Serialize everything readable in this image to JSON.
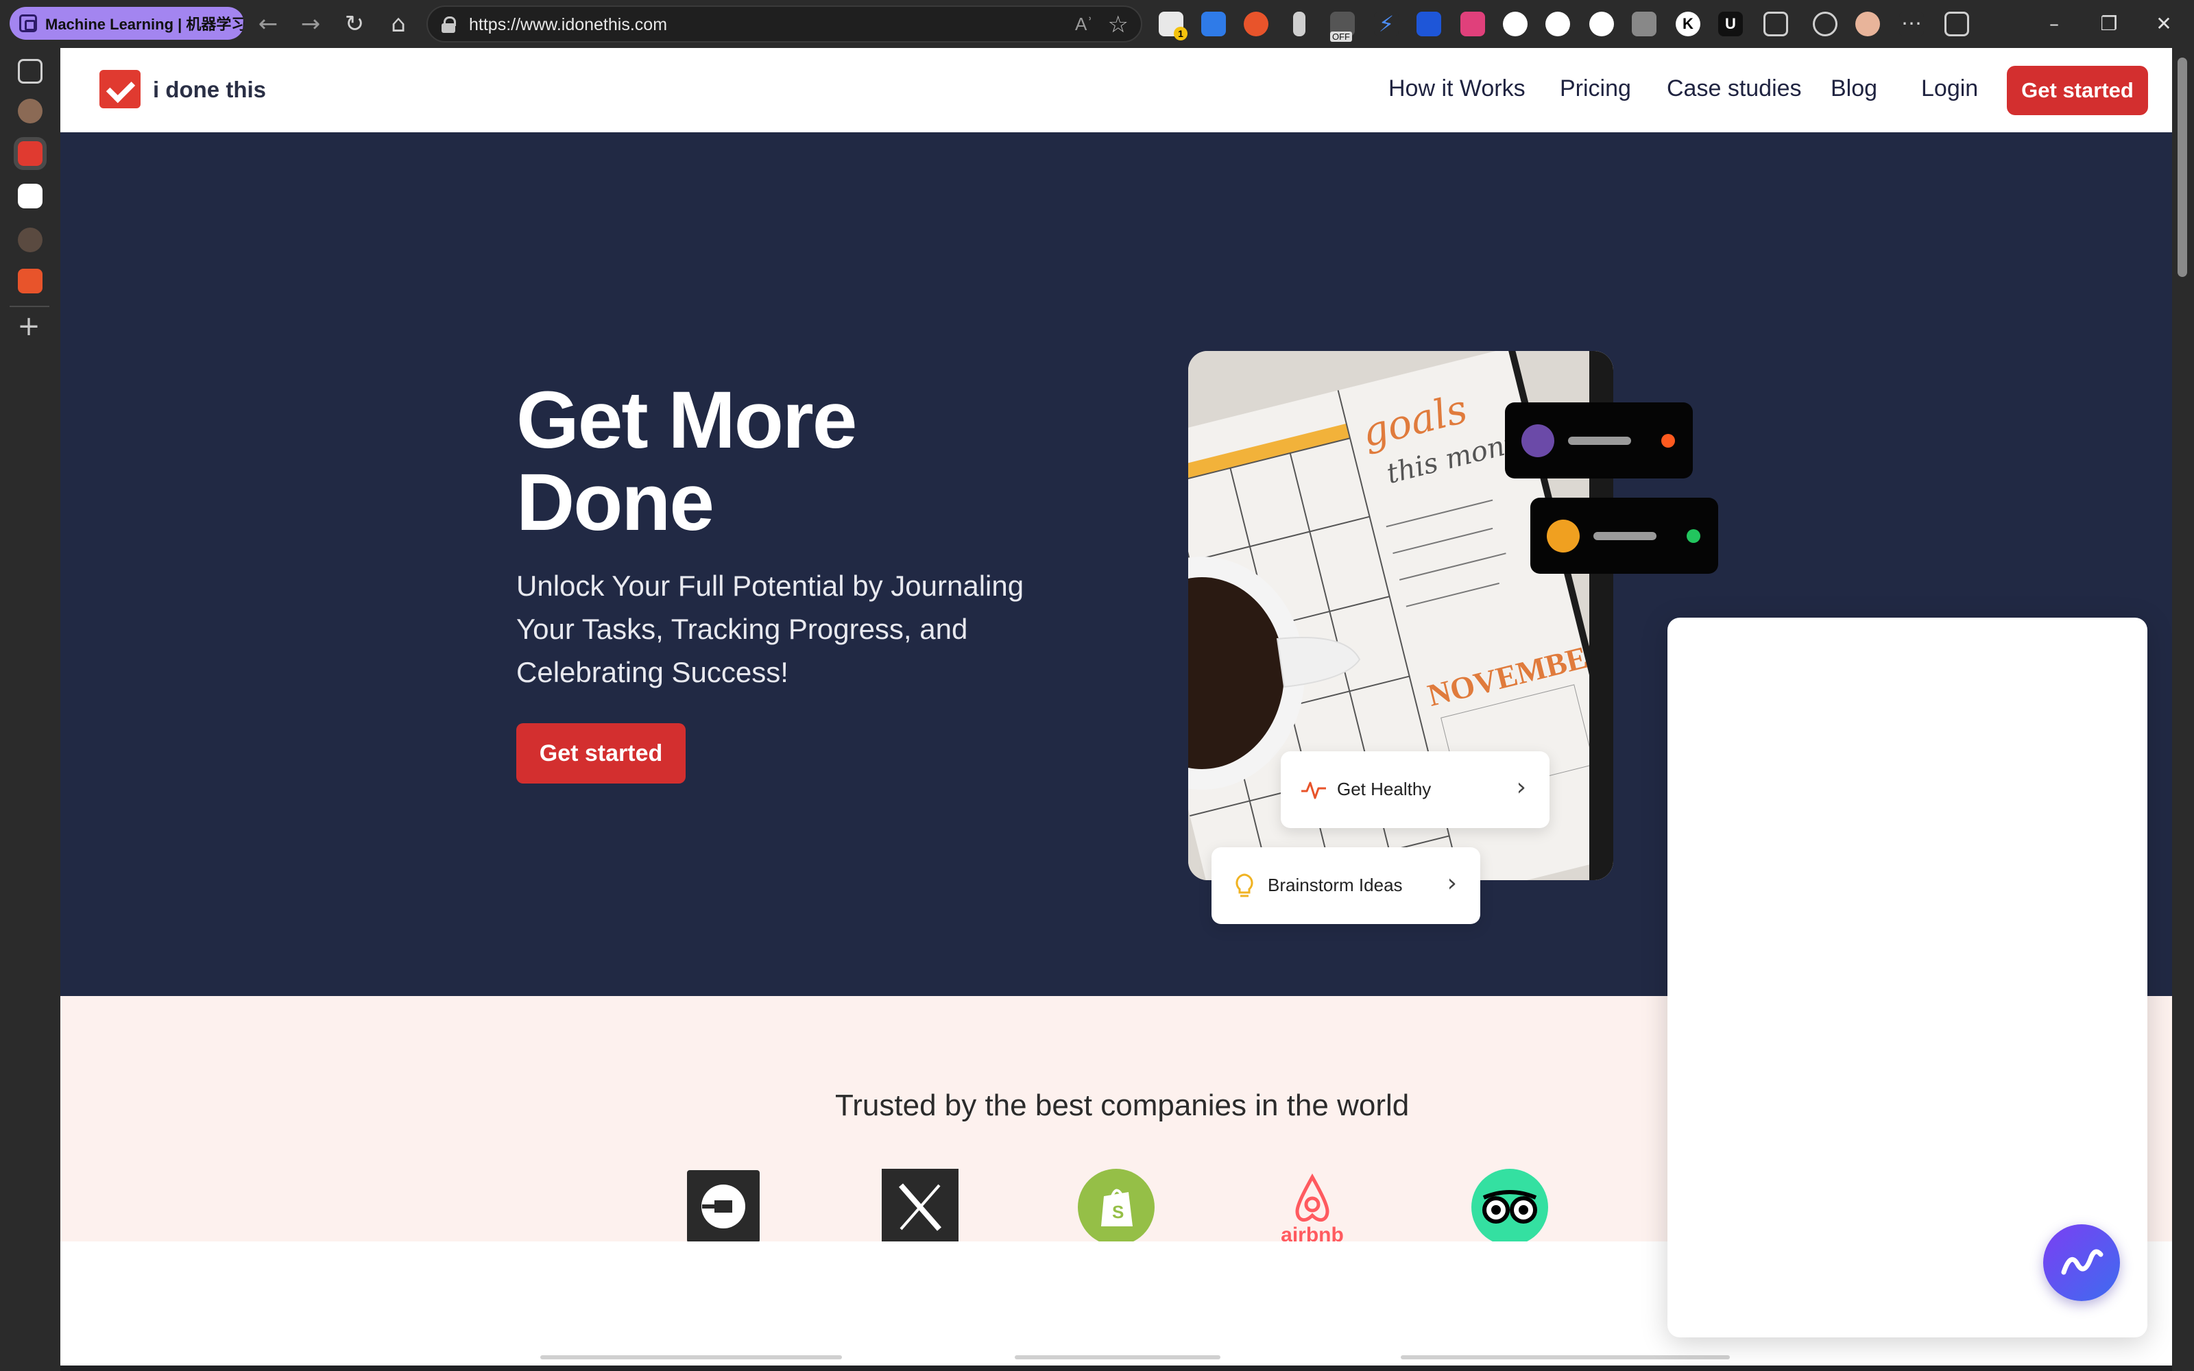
{
  "browser": {
    "profile_label": "Machine Learning | 机器学习",
    "url": "https://www.idonethis.com",
    "read_aloud": "Aʾ",
    "nav_icons": {
      "back": "←",
      "forward": "→",
      "refresh": "↻",
      "home": "⌂"
    },
    "star_glyph": "☆",
    "window_controls": {
      "minimize": "–",
      "restore": "❐",
      "close": "✕"
    },
    "more_glyph": "⋯",
    "add_tab_glyph": "+",
    "extension_badges": {
      "ext1": "1",
      "ext_off": "OFF",
      "ext_k": "K",
      "ext_u": "U"
    }
  },
  "site": {
    "logo_text": "i done this",
    "nav": {
      "how_it_works": "How it Works",
      "pricing": "Pricing",
      "case_studies": "Case studies",
      "blog": "Blog",
      "login": "Login",
      "get_started": "Get started"
    },
    "hero": {
      "title": "Get More Done",
      "subtitle": "Unlock Your Full Potential by Journaling Your Tasks, Tracking Progress, and Celebrating Success!",
      "cta": "Get started",
      "photo_text": {
        "goals": "goals",
        "this_month": "this month",
        "month_name": "NOVEMBER"
      },
      "chips": {
        "healthy": {
          "label": "Get Healthy",
          "arrow": "›"
        },
        "brainstorm": {
          "label": "Brainstorm Ideas",
          "arrow": "›"
        }
      },
      "status_colors": {
        "user1": "#ff5a1f",
        "user2": "#22c55e"
      }
    },
    "trusted": {
      "title": "Trusted by the best companies in the world",
      "brands": [
        "uber-logo",
        "x-logo",
        "shopify-logo",
        "airbnb-logo",
        "tripadvisor-logo"
      ],
      "airbnb_label": "airbnb"
    }
  },
  "colors": {
    "hero_bg": "#212944",
    "accent_red": "#d32f2f",
    "trusted_bg": "#fdf1ee"
  }
}
